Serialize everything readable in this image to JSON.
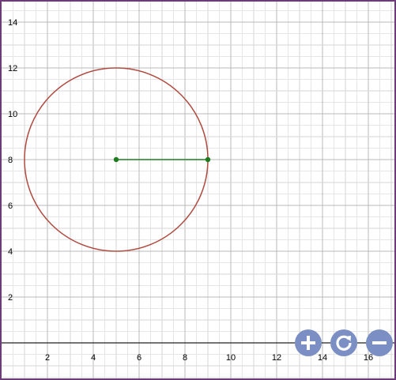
{
  "chart_data": {
    "type": "scatter",
    "xlim": [
      0,
      17
    ],
    "ylim": [
      -1.5,
      15
    ],
    "grid": "on",
    "x_ticks": [
      "2",
      "4",
      "6",
      "8",
      "10",
      "12",
      "14",
      "16"
    ],
    "y_ticks": [
      "2",
      "4",
      "6",
      "8",
      "10",
      "12",
      "14"
    ],
    "circle": {
      "center": [
        5,
        8
      ],
      "radius": 4,
      "color": "#b04a3f"
    },
    "segment": {
      "start": [
        5,
        8
      ],
      "end": [
        9,
        8
      ],
      "color": "#1e7b1e"
    },
    "points": [
      {
        "x": 5,
        "y": 8,
        "color": "#1e7b1e"
      },
      {
        "x": 9,
        "y": 8,
        "color": "#1e7b1e"
      }
    ]
  },
  "controls": {
    "zoom_in": {
      "icon": "plus-icon"
    },
    "reset": {
      "icon": "reset-icon"
    },
    "zoom_out": {
      "icon": "minus-icon"
    },
    "button_color": "#7b8fc4"
  }
}
